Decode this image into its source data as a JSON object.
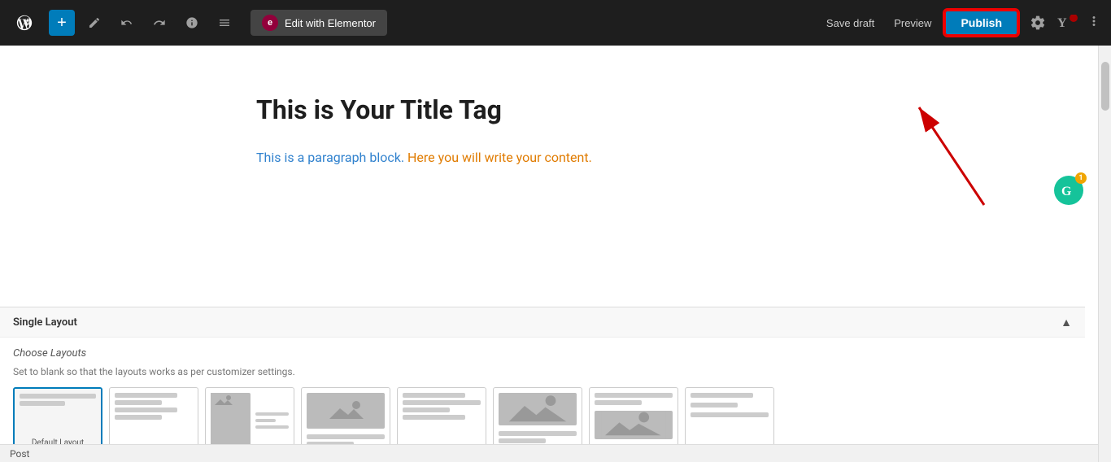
{
  "toolbar": {
    "add_label": "+",
    "edit_elementor_label": "Edit with Elementor",
    "save_draft_label": "Save draft",
    "preview_label": "Preview",
    "publish_label": "Publish"
  },
  "editor": {
    "title": "This is Your Title Tag",
    "paragraph_blue": "This is a paragraph block.",
    "paragraph_orange": "Here you will write your content."
  },
  "bottom_panel": {
    "title": "Single Layout",
    "choose_label": "Choose Layouts",
    "hint": "Set to blank so that the layouts works as per customizer settings.",
    "layouts": [
      {
        "id": "default",
        "label": "Default Layout",
        "selected": true
      },
      {
        "id": "layout2",
        "label": "",
        "selected": false
      },
      {
        "id": "layout3",
        "label": "",
        "selected": false
      },
      {
        "id": "layout4",
        "label": "",
        "selected": false
      },
      {
        "id": "layout5",
        "label": "",
        "selected": false
      },
      {
        "id": "layout6",
        "label": "",
        "selected": false
      },
      {
        "id": "layout7",
        "label": "",
        "selected": false
      },
      {
        "id": "layout8",
        "label": "",
        "selected": false
      }
    ]
  },
  "status_bar": {
    "label": "Post"
  }
}
